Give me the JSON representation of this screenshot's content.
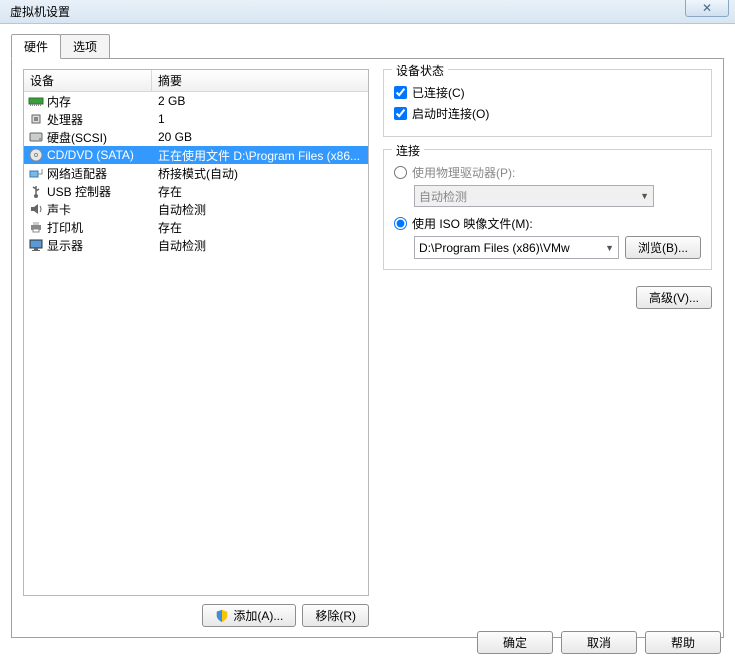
{
  "titlebar": {
    "title": "虚拟机设置"
  },
  "tabs": {
    "hardware": "硬件",
    "options": "选项"
  },
  "columns": {
    "device": "设备",
    "summary": "摘要"
  },
  "devices": [
    {
      "name": "内存",
      "summary": "2 GB",
      "icon": "memory"
    },
    {
      "name": "处理器",
      "summary": "1",
      "icon": "cpu"
    },
    {
      "name": "硬盘(SCSI)",
      "summary": "20 GB",
      "icon": "hdd"
    },
    {
      "name": "CD/DVD (SATA)",
      "summary": "正在使用文件 D:\\Program Files (x86...",
      "icon": "cd"
    },
    {
      "name": "网络适配器",
      "summary": "桥接模式(自动)",
      "icon": "net"
    },
    {
      "name": "USB 控制器",
      "summary": "存在",
      "icon": "usb"
    },
    {
      "name": "声卡",
      "summary": "自动检测",
      "icon": "sound"
    },
    {
      "name": "打印机",
      "summary": "存在",
      "icon": "printer"
    },
    {
      "name": "显示器",
      "summary": "自动检测",
      "icon": "display"
    }
  ],
  "left_buttons": {
    "add": "添加(A)...",
    "remove": "移除(R)"
  },
  "group_status": {
    "title": "设备状态",
    "connected": "已连接(C)",
    "connect_at_poweron": "启动时连接(O)"
  },
  "group_connection": {
    "title": "连接",
    "use_physical": "使用物理驱动器(P):",
    "auto_detect": "自动检测",
    "use_iso": "使用 ISO 映像文件(M):",
    "iso_path": "D:\\Program Files (x86)\\VMw",
    "browse": "浏览(B)..."
  },
  "advanced": "高级(V)...",
  "bottom": {
    "ok": "确定",
    "cancel": "取消",
    "help": "帮助"
  }
}
